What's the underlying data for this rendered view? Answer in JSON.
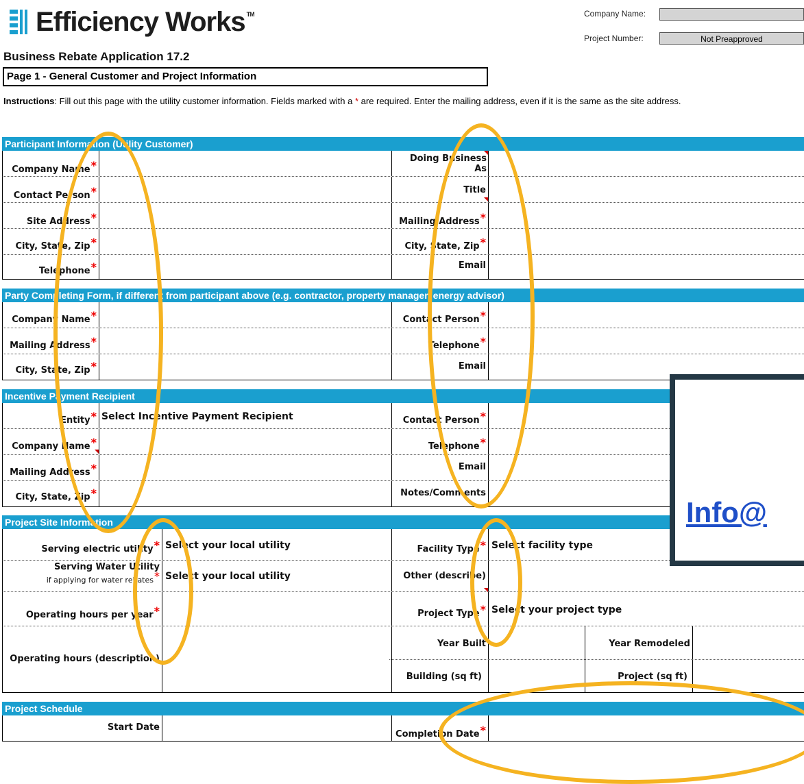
{
  "header": {
    "brand": "Efficiency Works",
    "tm": "TM",
    "company_name_label": "Company Name:",
    "company_name_value": "",
    "project_number_label": "Project Number:",
    "project_number_value": "Not Preapproved",
    "app_title": "Business Rebate Application 17.2",
    "page_title": "Page 1 - General Customer and Project Information"
  },
  "instructions": {
    "bold": "Instructions",
    "text1": ": Fill out this page with the utility customer information. Fields marked with a ",
    "star": "*",
    "text2": " are required. Enter the mailing address, even if it is the same as the site address."
  },
  "participant": {
    "title": "Participant Information (Utility Customer)",
    "company_name": "Company Name",
    "doing_business": "Doing Business",
    "doing_business_as": "As",
    "contact_person": "Contact Person",
    "title_label": "Title",
    "site_address": "Site Address",
    "mailing_address": "Mailing Address",
    "city_state_zip": "City, State, Zip",
    "city_state_zip2": "City, State, Zip",
    "telephone": "Telephone",
    "email": "Email"
  },
  "party": {
    "title": "Party Completing Form, if different from participant above (e.g. contractor, property manager, energy advisor)",
    "company_name": "Company Name",
    "contact_person": "Contact Person",
    "mailing_address": "Mailing Address",
    "telephone": "Telephone",
    "city_state_zip": "City, State, Zip",
    "email": "Email"
  },
  "incentive": {
    "title": "Incentive Payment Recipient",
    "entity": "Entity",
    "entity_value": "Select Incentive Payment Recipient",
    "contact_person": "Contact Person",
    "company_name": "Company Name",
    "telephone": "Telephone",
    "mailing_address": "Mailing Address",
    "email": "Email",
    "city_state_zip": "City, State, Zip",
    "notes": "Notes/Comments"
  },
  "project_site": {
    "title": "Project Site Information",
    "serving_electric": "Serving electric utility",
    "serving_electric_value": "Select your local utility",
    "facility_type": "Facility Type",
    "facility_type_value": "Select facility type",
    "serving_water": "Serving Water Utility",
    "serving_water_sub": "if applying for water rebates",
    "serving_water_value": "Select your local utility",
    "other_describe": "Other (describe)",
    "operating_hours_year": "Operating hours per year",
    "project_type": "Project Type",
    "project_type_value": "Select your project type",
    "operating_hours_desc": "Operating hours (description)",
    "year_built": "Year Built",
    "year_remodeled": "Year Remodeled",
    "building_sqft": "Building (sq ft)",
    "project_sqft": "Project (sq ft)"
  },
  "schedule": {
    "title": "Project Schedule",
    "start_date": "Start Date",
    "completion_date": "Completion Date"
  },
  "popup": {
    "link_text": "Info@"
  },
  "colors": {
    "section_header": "#1a9fcf",
    "highlight_oval": "#f5b321",
    "popup_border": "#243845",
    "required_star": "#e00000"
  }
}
